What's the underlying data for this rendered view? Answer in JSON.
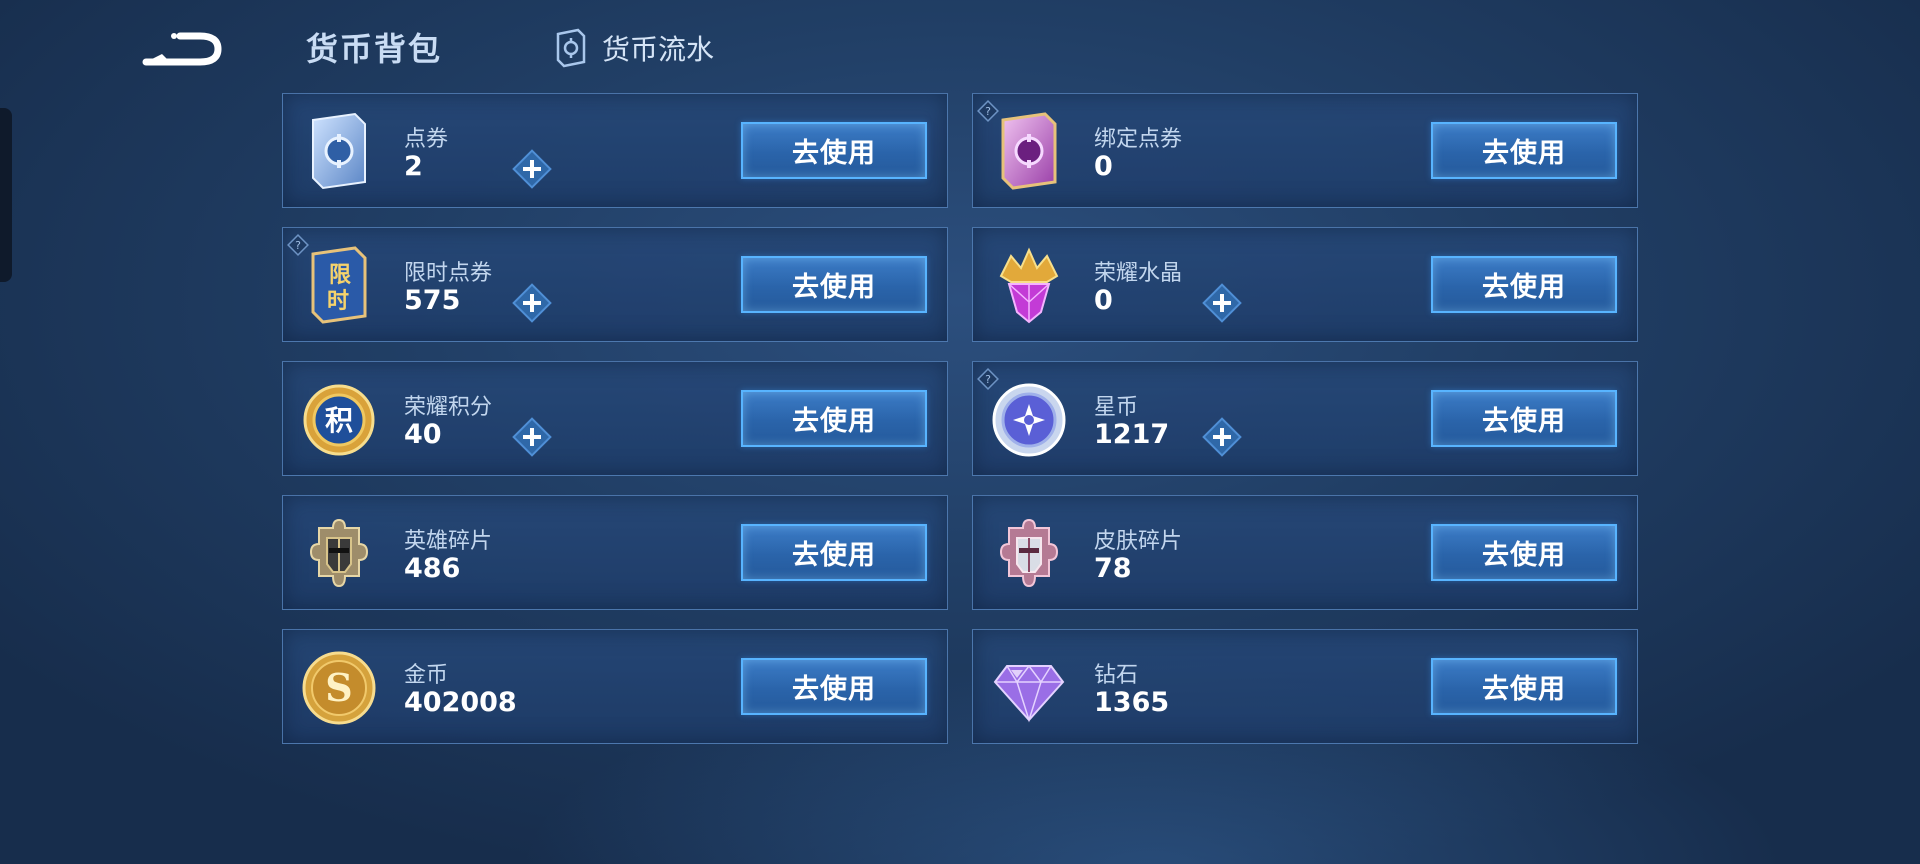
{
  "header": {
    "title": "货币背包",
    "flow_tab": "货币流水"
  },
  "currencies": [
    {
      "name": "点券",
      "amount": "2",
      "icon": "voucher-icon",
      "plus": true,
      "help": false,
      "button": "去使用"
    },
    {
      "name": "绑定点券",
      "amount": "0",
      "icon": "bound-voucher-icon",
      "plus": false,
      "help": true,
      "button": "去使用"
    },
    {
      "name": "限时点券",
      "amount": "575",
      "icon": "limited-voucher-icon",
      "plus": true,
      "help": true,
      "button": "去使用"
    },
    {
      "name": "荣耀水晶",
      "amount": "0",
      "icon": "glory-crystal-icon",
      "plus": true,
      "help": false,
      "button": "去使用"
    },
    {
      "name": "荣耀积分",
      "amount": "40",
      "icon": "glory-points-icon",
      "plus": true,
      "help": false,
      "button": "去使用",
      "icon_text": "积"
    },
    {
      "name": "星币",
      "amount": "1217",
      "icon": "star-coin-icon",
      "plus": true,
      "help": true,
      "button": "去使用"
    },
    {
      "name": "英雄碎片",
      "amount": "486",
      "icon": "hero-fragment-icon",
      "plus": false,
      "help": false,
      "button": "去使用"
    },
    {
      "name": "皮肤碎片",
      "amount": "78",
      "icon": "skin-fragment-icon",
      "plus": false,
      "help": false,
      "button": "去使用"
    },
    {
      "name": "金币",
      "amount": "402008",
      "icon": "gold-coin-icon",
      "plus": false,
      "help": false,
      "button": "去使用",
      "icon_text": "S"
    },
    {
      "name": "钻石",
      "amount": "1365",
      "icon": "diamond-icon",
      "plus": false,
      "help": false,
      "button": "去使用"
    }
  ],
  "limited_icon_text": [
    "限",
    "时"
  ],
  "colors": {
    "button_border": "#58b4ff",
    "button_fill": "#2a64aa",
    "plus_fill": "#2f68a8"
  }
}
